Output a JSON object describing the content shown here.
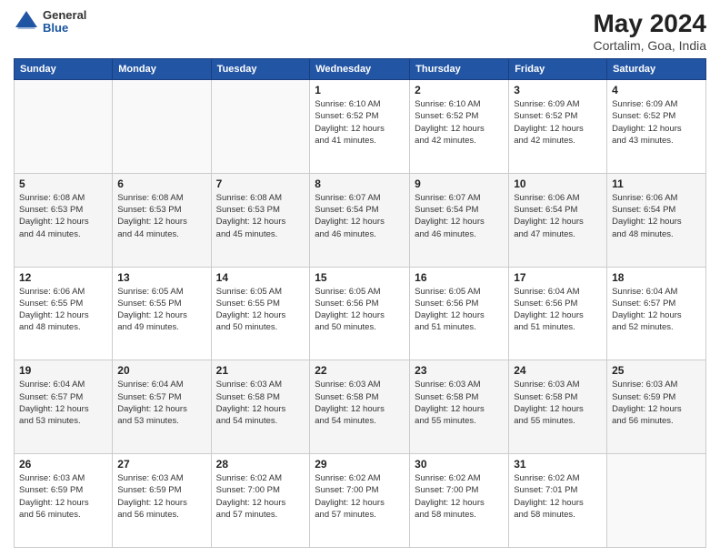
{
  "header": {
    "logo_general": "General",
    "logo_blue": "Blue",
    "main_title": "May 2024",
    "sub_title": "Cortalim, Goa, India"
  },
  "calendar": {
    "days_of_week": [
      "Sunday",
      "Monday",
      "Tuesday",
      "Wednesday",
      "Thursday",
      "Friday",
      "Saturday"
    ],
    "weeks": [
      [
        {
          "day": "",
          "info": ""
        },
        {
          "day": "",
          "info": ""
        },
        {
          "day": "",
          "info": ""
        },
        {
          "day": "1",
          "info": "Sunrise: 6:10 AM\nSunset: 6:52 PM\nDaylight: 12 hours\nand 41 minutes."
        },
        {
          "day": "2",
          "info": "Sunrise: 6:10 AM\nSunset: 6:52 PM\nDaylight: 12 hours\nand 42 minutes."
        },
        {
          "day": "3",
          "info": "Sunrise: 6:09 AM\nSunset: 6:52 PM\nDaylight: 12 hours\nand 42 minutes."
        },
        {
          "day": "4",
          "info": "Sunrise: 6:09 AM\nSunset: 6:52 PM\nDaylight: 12 hours\nand 43 minutes."
        }
      ],
      [
        {
          "day": "5",
          "info": "Sunrise: 6:08 AM\nSunset: 6:53 PM\nDaylight: 12 hours\nand 44 minutes."
        },
        {
          "day": "6",
          "info": "Sunrise: 6:08 AM\nSunset: 6:53 PM\nDaylight: 12 hours\nand 44 minutes."
        },
        {
          "day": "7",
          "info": "Sunrise: 6:08 AM\nSunset: 6:53 PM\nDaylight: 12 hours\nand 45 minutes."
        },
        {
          "day": "8",
          "info": "Sunrise: 6:07 AM\nSunset: 6:54 PM\nDaylight: 12 hours\nand 46 minutes."
        },
        {
          "day": "9",
          "info": "Sunrise: 6:07 AM\nSunset: 6:54 PM\nDaylight: 12 hours\nand 46 minutes."
        },
        {
          "day": "10",
          "info": "Sunrise: 6:06 AM\nSunset: 6:54 PM\nDaylight: 12 hours\nand 47 minutes."
        },
        {
          "day": "11",
          "info": "Sunrise: 6:06 AM\nSunset: 6:54 PM\nDaylight: 12 hours\nand 48 minutes."
        }
      ],
      [
        {
          "day": "12",
          "info": "Sunrise: 6:06 AM\nSunset: 6:55 PM\nDaylight: 12 hours\nand 48 minutes."
        },
        {
          "day": "13",
          "info": "Sunrise: 6:05 AM\nSunset: 6:55 PM\nDaylight: 12 hours\nand 49 minutes."
        },
        {
          "day": "14",
          "info": "Sunrise: 6:05 AM\nSunset: 6:55 PM\nDaylight: 12 hours\nand 50 minutes."
        },
        {
          "day": "15",
          "info": "Sunrise: 6:05 AM\nSunset: 6:56 PM\nDaylight: 12 hours\nand 50 minutes."
        },
        {
          "day": "16",
          "info": "Sunrise: 6:05 AM\nSunset: 6:56 PM\nDaylight: 12 hours\nand 51 minutes."
        },
        {
          "day": "17",
          "info": "Sunrise: 6:04 AM\nSunset: 6:56 PM\nDaylight: 12 hours\nand 51 minutes."
        },
        {
          "day": "18",
          "info": "Sunrise: 6:04 AM\nSunset: 6:57 PM\nDaylight: 12 hours\nand 52 minutes."
        }
      ],
      [
        {
          "day": "19",
          "info": "Sunrise: 6:04 AM\nSunset: 6:57 PM\nDaylight: 12 hours\nand 53 minutes."
        },
        {
          "day": "20",
          "info": "Sunrise: 6:04 AM\nSunset: 6:57 PM\nDaylight: 12 hours\nand 53 minutes."
        },
        {
          "day": "21",
          "info": "Sunrise: 6:03 AM\nSunset: 6:58 PM\nDaylight: 12 hours\nand 54 minutes."
        },
        {
          "day": "22",
          "info": "Sunrise: 6:03 AM\nSunset: 6:58 PM\nDaylight: 12 hours\nand 54 minutes."
        },
        {
          "day": "23",
          "info": "Sunrise: 6:03 AM\nSunset: 6:58 PM\nDaylight: 12 hours\nand 55 minutes."
        },
        {
          "day": "24",
          "info": "Sunrise: 6:03 AM\nSunset: 6:58 PM\nDaylight: 12 hours\nand 55 minutes."
        },
        {
          "day": "25",
          "info": "Sunrise: 6:03 AM\nSunset: 6:59 PM\nDaylight: 12 hours\nand 56 minutes."
        }
      ],
      [
        {
          "day": "26",
          "info": "Sunrise: 6:03 AM\nSunset: 6:59 PM\nDaylight: 12 hours\nand 56 minutes."
        },
        {
          "day": "27",
          "info": "Sunrise: 6:03 AM\nSunset: 6:59 PM\nDaylight: 12 hours\nand 56 minutes."
        },
        {
          "day": "28",
          "info": "Sunrise: 6:02 AM\nSunset: 7:00 PM\nDaylight: 12 hours\nand 57 minutes."
        },
        {
          "day": "29",
          "info": "Sunrise: 6:02 AM\nSunset: 7:00 PM\nDaylight: 12 hours\nand 57 minutes."
        },
        {
          "day": "30",
          "info": "Sunrise: 6:02 AM\nSunset: 7:00 PM\nDaylight: 12 hours\nand 58 minutes."
        },
        {
          "day": "31",
          "info": "Sunrise: 6:02 AM\nSunset: 7:01 PM\nDaylight: 12 hours\nand 58 minutes."
        },
        {
          "day": "",
          "info": ""
        }
      ]
    ]
  }
}
